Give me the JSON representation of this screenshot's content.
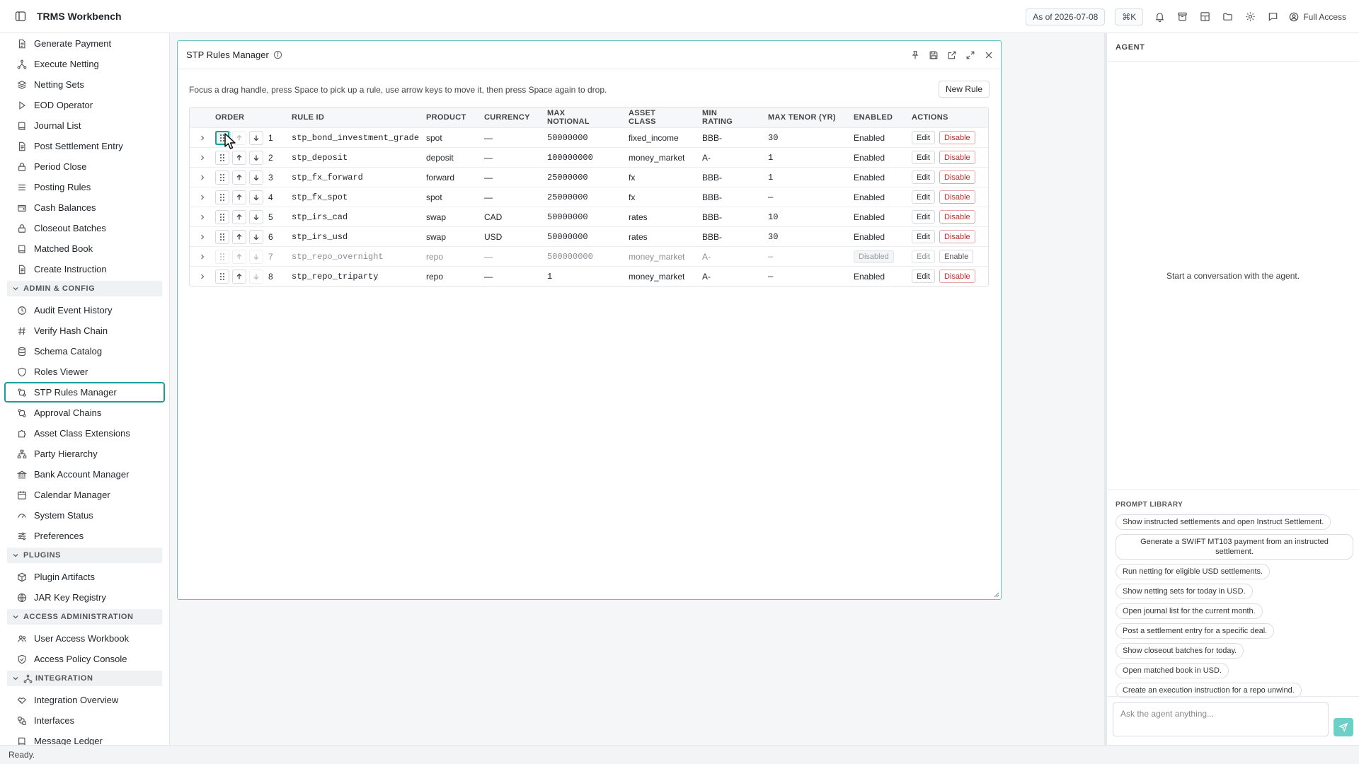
{
  "app": {
    "title": "TRMS Workbench",
    "as_of": "As of 2026-07-08",
    "shortcut": "⌘K",
    "access": "Full Access"
  },
  "sidebar": {
    "items_top": [
      {
        "label": "Generate Payment",
        "icon": "document-icon"
      },
      {
        "label": "Execute Netting",
        "icon": "network-icon"
      },
      {
        "label": "Netting Sets",
        "icon": "layers-icon"
      },
      {
        "label": "EOD Operator",
        "icon": "play-icon"
      },
      {
        "label": "Journal List",
        "icon": "book-icon"
      },
      {
        "label": "Post Settlement Entry",
        "icon": "document-icon"
      },
      {
        "label": "Period Close",
        "icon": "lock-icon"
      },
      {
        "label": "Posting Rules",
        "icon": "list-icon"
      },
      {
        "label": "Cash Balances",
        "icon": "wallet-icon"
      },
      {
        "label": "Closeout Batches",
        "icon": "lock-icon"
      },
      {
        "label": "Matched Book",
        "icon": "book-icon"
      },
      {
        "label": "Create Instruction",
        "icon": "document-icon"
      }
    ],
    "section_admin": "ADMIN & CONFIG",
    "items_admin": [
      {
        "label": "Audit Event History",
        "icon": "history-icon"
      },
      {
        "label": "Verify Hash Chain",
        "icon": "hash-icon"
      },
      {
        "label": "Schema Catalog",
        "icon": "database-icon"
      },
      {
        "label": "Roles Viewer",
        "icon": "shield-icon"
      },
      {
        "label": "STP Rules Manager",
        "icon": "workflow-icon"
      },
      {
        "label": "Approval Chains",
        "icon": "workflow-icon"
      },
      {
        "label": "Asset Class Extensions",
        "icon": "puzzle-icon"
      },
      {
        "label": "Party Hierarchy",
        "icon": "hierarchy-icon"
      },
      {
        "label": "Bank Account Manager",
        "icon": "bank-icon"
      },
      {
        "label": "Calendar Manager",
        "icon": "calendar-icon"
      },
      {
        "label": "System Status",
        "icon": "gauge-icon"
      },
      {
        "label": "Preferences",
        "icon": "sliders-icon"
      }
    ],
    "section_plugins": "PLUGINS",
    "items_plugins": [
      {
        "label": "Plugin Artifacts",
        "icon": "package-icon"
      },
      {
        "label": "JAR Key Registry",
        "icon": "globe-icon"
      }
    ],
    "section_access": "ACCESS ADMINISTRATION",
    "items_access": [
      {
        "label": "User Access Workbook",
        "icon": "users-icon"
      },
      {
        "label": "Access Policy Console",
        "icon": "shield-check-icon"
      }
    ],
    "section_integration": "INTEGRATION",
    "items_integration": [
      {
        "label": "Integration Overview",
        "icon": "handshake-icon"
      },
      {
        "label": "Interfaces",
        "icon": "interfaces-icon"
      },
      {
        "label": "Message Ledger",
        "icon": "book-icon"
      }
    ]
  },
  "panel": {
    "title": "STP Rules Manager",
    "help": "Focus a drag handle, press Space to pick up a rule, use arrow keys to move it, then press Space again to drop.",
    "new_rule": "New Rule",
    "columns": [
      "ORDER",
      "RULE ID",
      "PRODUCT",
      "CURRENCY",
      "MAX NOTIONAL",
      "ASSET CLASS",
      "MIN RATING",
      "MAX TENOR (YR)",
      "ENABLED",
      "ACTIONS"
    ],
    "rules": [
      {
        "order": "1",
        "id": "stp_bond_investment_grade",
        "product": "spot",
        "currency": "—",
        "notional": "50000000",
        "asset": "fixed_income",
        "rating": "BBB-",
        "tenor": "30",
        "enabled": "Enabled",
        "edit": "Edit",
        "toggle": "Disable"
      },
      {
        "order": "2",
        "id": "stp_deposit",
        "product": "deposit",
        "currency": "—",
        "notional": "100000000",
        "asset": "money_market",
        "rating": "A-",
        "tenor": "1",
        "enabled": "Enabled",
        "edit": "Edit",
        "toggle": "Disable"
      },
      {
        "order": "3",
        "id": "stp_fx_forward",
        "product": "forward",
        "currency": "—",
        "notional": "25000000",
        "asset": "fx",
        "rating": "BBB-",
        "tenor": "1",
        "enabled": "Enabled",
        "edit": "Edit",
        "toggle": "Disable"
      },
      {
        "order": "4",
        "id": "stp_fx_spot",
        "product": "spot",
        "currency": "—",
        "notional": "25000000",
        "asset": "fx",
        "rating": "BBB-",
        "tenor": "—",
        "enabled": "Enabled",
        "edit": "Edit",
        "toggle": "Disable"
      },
      {
        "order": "5",
        "id": "stp_irs_cad",
        "product": "swap",
        "currency": "CAD",
        "notional": "50000000",
        "asset": "rates",
        "rating": "BBB-",
        "tenor": "10",
        "enabled": "Enabled",
        "edit": "Edit",
        "toggle": "Disable"
      },
      {
        "order": "6",
        "id": "stp_irs_usd",
        "product": "swap",
        "currency": "USD",
        "notional": "50000000",
        "asset": "rates",
        "rating": "BBB-",
        "tenor": "30",
        "enabled": "Enabled",
        "edit": "Edit",
        "toggle": "Disable"
      },
      {
        "order": "7",
        "id": "stp_repo_overnight",
        "product": "repo",
        "currency": "—",
        "notional": "500000000",
        "asset": "money_market",
        "rating": "A-",
        "tenor": "—",
        "enabled": "Disabled",
        "edit": "Edit",
        "toggle": "Enable"
      },
      {
        "order": "8",
        "id": "stp_repo_triparty",
        "product": "repo",
        "currency": "—",
        "notional": "1",
        "asset": "money_market",
        "rating": "A-",
        "tenor": "—",
        "enabled": "Enabled",
        "edit": "Edit",
        "toggle": "Disable"
      }
    ]
  },
  "agent": {
    "title": "AGENT",
    "empty": "Start a conversation with the agent.",
    "library_title": "PROMPT LIBRARY",
    "prompts": [
      "Show instructed settlements and open Instruct Settlement.",
      "Generate a SWIFT MT103 payment from an instructed settlement.",
      "Run netting for eligible USD settlements.",
      "Show netting sets for today in USD.",
      "Open journal list for the current month.",
      "Post a settlement entry for a specific deal.",
      "Show closeout batches for today.",
      "Open matched book in USD.",
      "Create an execution instruction for a repo unwind."
    ],
    "input_placeholder": "Ask the agent anything..."
  },
  "status": "Ready.",
  "colors": {
    "accent": "#1a9e9a",
    "danger": "#c62828"
  }
}
